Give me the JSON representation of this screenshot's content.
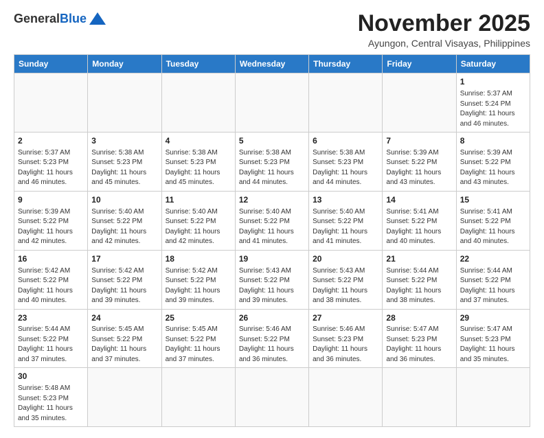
{
  "header": {
    "logo": {
      "general": "General",
      "blue": "Blue"
    },
    "month": "November 2025",
    "location": "Ayungon, Central Visayas, Philippines"
  },
  "weekdays": [
    "Sunday",
    "Monday",
    "Tuesday",
    "Wednesday",
    "Thursday",
    "Friday",
    "Saturday"
  ],
  "days": [
    {
      "date": null,
      "empty": true
    },
    {
      "date": null,
      "empty": true
    },
    {
      "date": null,
      "empty": true
    },
    {
      "date": null,
      "empty": true
    },
    {
      "date": null,
      "empty": true
    },
    {
      "date": null,
      "empty": true
    },
    {
      "date": 1,
      "sunrise": "5:37 AM",
      "sunset": "5:24 PM",
      "daylight": "11 hours and 46 minutes."
    },
    {
      "date": 2,
      "sunrise": "5:37 AM",
      "sunset": "5:23 PM",
      "daylight": "11 hours and 46 minutes."
    },
    {
      "date": 3,
      "sunrise": "5:38 AM",
      "sunset": "5:23 PM",
      "daylight": "11 hours and 45 minutes."
    },
    {
      "date": 4,
      "sunrise": "5:38 AM",
      "sunset": "5:23 PM",
      "daylight": "11 hours and 45 minutes."
    },
    {
      "date": 5,
      "sunrise": "5:38 AM",
      "sunset": "5:23 PM",
      "daylight": "11 hours and 44 minutes."
    },
    {
      "date": 6,
      "sunrise": "5:38 AM",
      "sunset": "5:23 PM",
      "daylight": "11 hours and 44 minutes."
    },
    {
      "date": 7,
      "sunrise": "5:39 AM",
      "sunset": "5:22 PM",
      "daylight": "11 hours and 43 minutes."
    },
    {
      "date": 8,
      "sunrise": "5:39 AM",
      "sunset": "5:22 PM",
      "daylight": "11 hours and 43 minutes."
    },
    {
      "date": 9,
      "sunrise": "5:39 AM",
      "sunset": "5:22 PM",
      "daylight": "11 hours and 42 minutes."
    },
    {
      "date": 10,
      "sunrise": "5:40 AM",
      "sunset": "5:22 PM",
      "daylight": "11 hours and 42 minutes."
    },
    {
      "date": 11,
      "sunrise": "5:40 AM",
      "sunset": "5:22 PM",
      "daylight": "11 hours and 42 minutes."
    },
    {
      "date": 12,
      "sunrise": "5:40 AM",
      "sunset": "5:22 PM",
      "daylight": "11 hours and 41 minutes."
    },
    {
      "date": 13,
      "sunrise": "5:40 AM",
      "sunset": "5:22 PM",
      "daylight": "11 hours and 41 minutes."
    },
    {
      "date": 14,
      "sunrise": "5:41 AM",
      "sunset": "5:22 PM",
      "daylight": "11 hours and 40 minutes."
    },
    {
      "date": 15,
      "sunrise": "5:41 AM",
      "sunset": "5:22 PM",
      "daylight": "11 hours and 40 minutes."
    },
    {
      "date": 16,
      "sunrise": "5:42 AM",
      "sunset": "5:22 PM",
      "daylight": "11 hours and 40 minutes."
    },
    {
      "date": 17,
      "sunrise": "5:42 AM",
      "sunset": "5:22 PM",
      "daylight": "11 hours and 39 minutes."
    },
    {
      "date": 18,
      "sunrise": "5:42 AM",
      "sunset": "5:22 PM",
      "daylight": "11 hours and 39 minutes."
    },
    {
      "date": 19,
      "sunrise": "5:43 AM",
      "sunset": "5:22 PM",
      "daylight": "11 hours and 39 minutes."
    },
    {
      "date": 20,
      "sunrise": "5:43 AM",
      "sunset": "5:22 PM",
      "daylight": "11 hours and 38 minutes."
    },
    {
      "date": 21,
      "sunrise": "5:44 AM",
      "sunset": "5:22 PM",
      "daylight": "11 hours and 38 minutes."
    },
    {
      "date": 22,
      "sunrise": "5:44 AM",
      "sunset": "5:22 PM",
      "daylight": "11 hours and 37 minutes."
    },
    {
      "date": 23,
      "sunrise": "5:44 AM",
      "sunset": "5:22 PM",
      "daylight": "11 hours and 37 minutes."
    },
    {
      "date": 24,
      "sunrise": "5:45 AM",
      "sunset": "5:22 PM",
      "daylight": "11 hours and 37 minutes."
    },
    {
      "date": 25,
      "sunrise": "5:45 AM",
      "sunset": "5:22 PM",
      "daylight": "11 hours and 37 minutes."
    },
    {
      "date": 26,
      "sunrise": "5:46 AM",
      "sunset": "5:22 PM",
      "daylight": "11 hours and 36 minutes."
    },
    {
      "date": 27,
      "sunrise": "5:46 AM",
      "sunset": "5:23 PM",
      "daylight": "11 hours and 36 minutes."
    },
    {
      "date": 28,
      "sunrise": "5:47 AM",
      "sunset": "5:23 PM",
      "daylight": "11 hours and 36 minutes."
    },
    {
      "date": 29,
      "sunrise": "5:47 AM",
      "sunset": "5:23 PM",
      "daylight": "11 hours and 35 minutes."
    },
    {
      "date": 30,
      "sunrise": "5:48 AM",
      "sunset": "5:23 PM",
      "daylight": "11 hours and 35 minutes."
    }
  ],
  "labels": {
    "sunrise": "Sunrise:",
    "sunset": "Sunset:",
    "daylight": "Daylight:"
  }
}
